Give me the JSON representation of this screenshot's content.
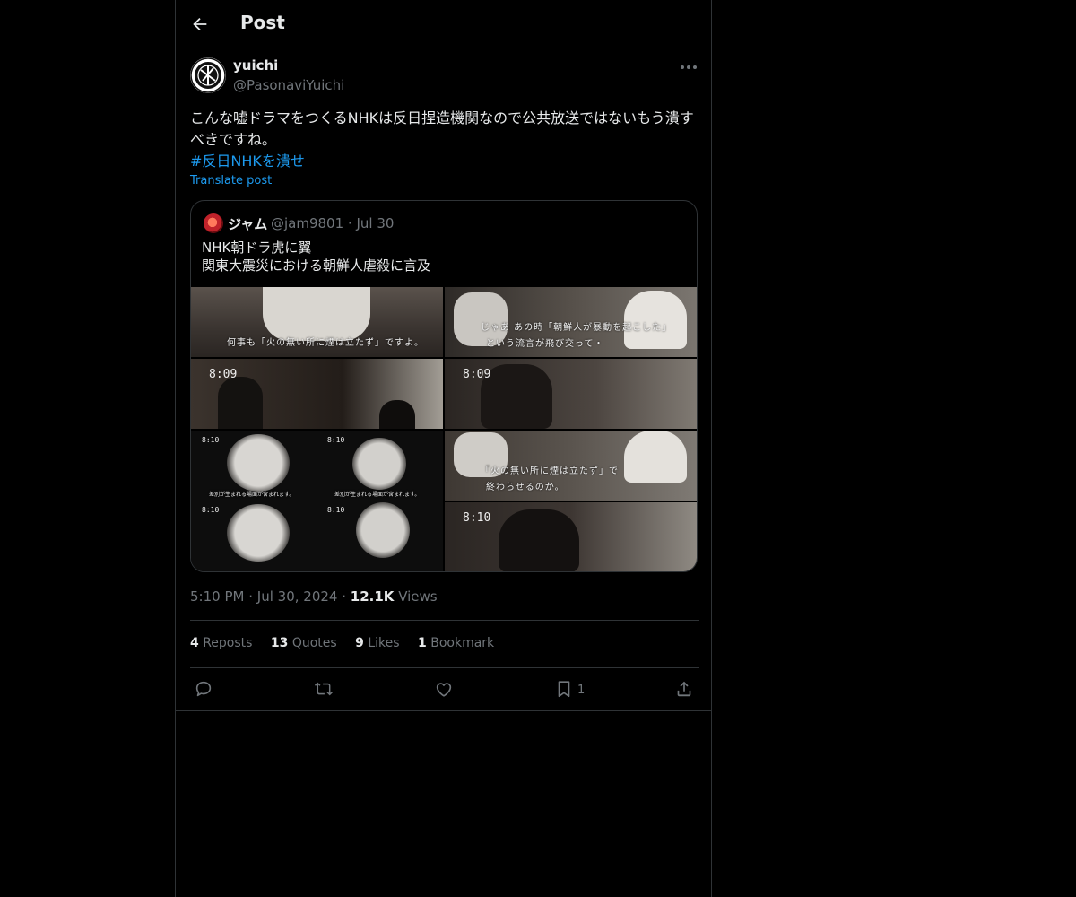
{
  "header": {
    "title": "Post"
  },
  "author": {
    "name": "yuichi",
    "handle": "@PasonaviYuichi"
  },
  "post": {
    "text": "こんな嘘ドラマをつくるNHKは反日捏造機関なので公共放送ではないもう潰すべきですね。",
    "hashtag": "#反日NHKを潰せ",
    "translate_label": "Translate post"
  },
  "quote": {
    "name": "ジャム",
    "meta": "@jam9801 · Jul 30",
    "line1": "NHK朝ドラ虎に翼",
    "line2": "関東大震災における朝鮮人虐殺に言及",
    "images": {
      "sub1": "何事も「火の無い所に煙は立たず」ですよ。",
      "sub2a": "じゃあ あの時「朝鮮人が暴動を起こした」",
      "sub2b": "という流言が飛び交って・",
      "ts_809": "8:09",
      "ts_810": "8:10",
      "sub_small": "差別が生まれる場面が含まれます。",
      "sub7a": "「火の無い所に煙は立たず」で",
      "sub7b": "終わらせるのか。"
    }
  },
  "timeline": {
    "time": "5:10 PM",
    "date": "Jul 30, 2024",
    "views": "12.1K",
    "views_label": "Views"
  },
  "stats": {
    "reposts": "4",
    "reposts_label": "Reposts",
    "quotes": "13",
    "quotes_label": "Quotes",
    "likes": "9",
    "likes_label": "Likes",
    "bookmarks": "1",
    "bookmarks_label": "Bookmark"
  },
  "actions": {
    "bookmark_count": "1"
  },
  "icons": [
    "back-arrow-icon",
    "more-icon",
    "reply-icon",
    "repost-icon",
    "like-icon",
    "bookmark-icon",
    "share-icon"
  ]
}
